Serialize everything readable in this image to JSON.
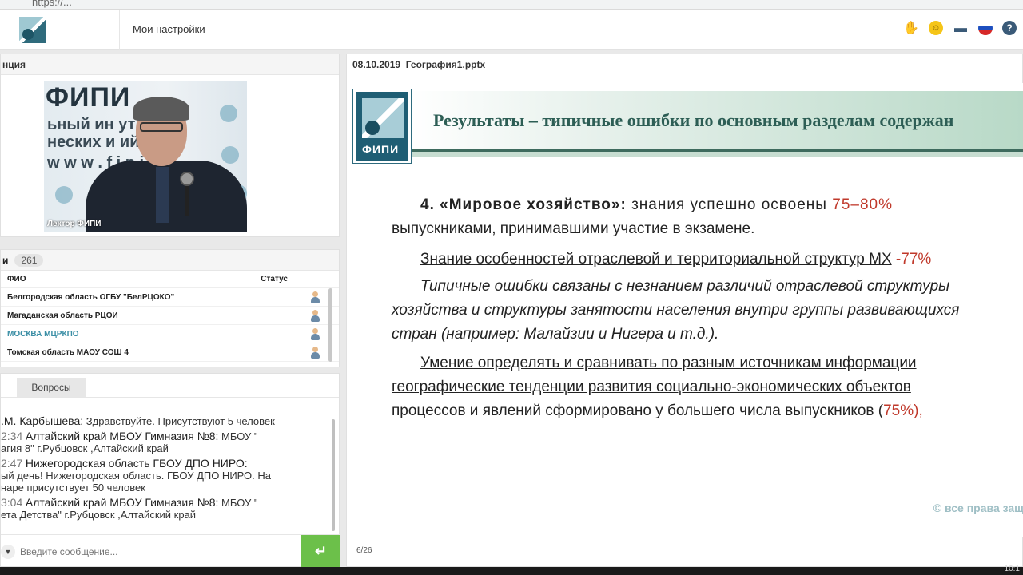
{
  "topbar": {
    "settings_label": "Мои настройки"
  },
  "icons": {
    "hand": "raise-hand-icon",
    "emoji": "emoji-icon",
    "folder": "folder-icon",
    "lang": "russian-flag-icon",
    "help": "help-icon"
  },
  "video": {
    "header": "нция",
    "sign_lines": [
      "ФИПИ",
      "ьный  ин   ут",
      "неских  и   ий",
      "w w w . f i p i"
    ],
    "speaker_label": "Лектор ФИПИ"
  },
  "participants": {
    "header": "и",
    "count": "261",
    "col_name": "ФИО",
    "col_status": "Статус",
    "rows": [
      {
        "name": "Белгородская область ОГБУ \"БелРЦОКО\""
      },
      {
        "name": "Магаданская область РЦОИ"
      },
      {
        "name": "МОСКВА МЦРКПО"
      },
      {
        "name": "Томская область МАОУ СОШ 4"
      }
    ]
  },
  "chat": {
    "tab_questions": "Вопросы",
    "messages": [
      {
        "time": "",
        "who": ".М. Карбышева:",
        "text": "Здравствуйте. Присутствуют 5 человек",
        "cont": ""
      },
      {
        "time": "2:34",
        "who": "Алтайский край МБОУ Гимназия №8:",
        "text": "МБОУ \"",
        "cont": "агия  8\" г.Рубцовск ,Алтайский край"
      },
      {
        "time": "2:47",
        "who": "Нижегородская область ГБОУ ДПО НИРО:",
        "text": "",
        "cont": "ый день! Нижегородская область. ГБОУ ДПО НИРО. На"
      },
      {
        "time": "",
        "who": "",
        "text": "",
        "cont": "наре присутствует 50 человек"
      },
      {
        "time": "3:04",
        "who": "Алтайский край МБОУ Гимназия №8:",
        "text": "МБОУ \"",
        "cont": "ета Детства\" г.Рубцовск ,Алтайский край"
      }
    ],
    "input_placeholder": "Введите сообщение...",
    "send_symbol": "↵"
  },
  "presentation": {
    "file_name": "08.10.2019_География1.pptx",
    "logo_text": "ФИПИ",
    "title": "Результаты – типичные ошибки по основным разделам содержан",
    "p1_num": "4.",
    "p1_bold": "«Мировое хозяйство»:",
    "p1_text": "знания успешно освоены",
    "p1_pct": "75–80%",
    "p1_text2": "выпускниками, принимавшими участие в экзамене.",
    "p2_under": "Знание особенностей отраслевой и территориальной структур МХ",
    "p2_pct": "-77%",
    "p3_l1": "Типичные ошибки связаны с незнанием различий отраслевой структуры",
    "p3_l2": "хозяйства и структуры занятости населения внутри группы развивающихся",
    "p3_l3": "стран (например: Малайзии и Нигера и т.д.).",
    "p4_l1": "Умение определять и сравнивать по разным источникам информации",
    "p4_l2": "географические тенденции развития социально-экономических объектов",
    "p4_l3": "процессов и явлений сформировано у большего числа выпускников (",
    "p4_pct": "75%),",
    "copyright": "© все права защ",
    "page": "6/26"
  },
  "taskbar": {
    "time": "10:1"
  }
}
